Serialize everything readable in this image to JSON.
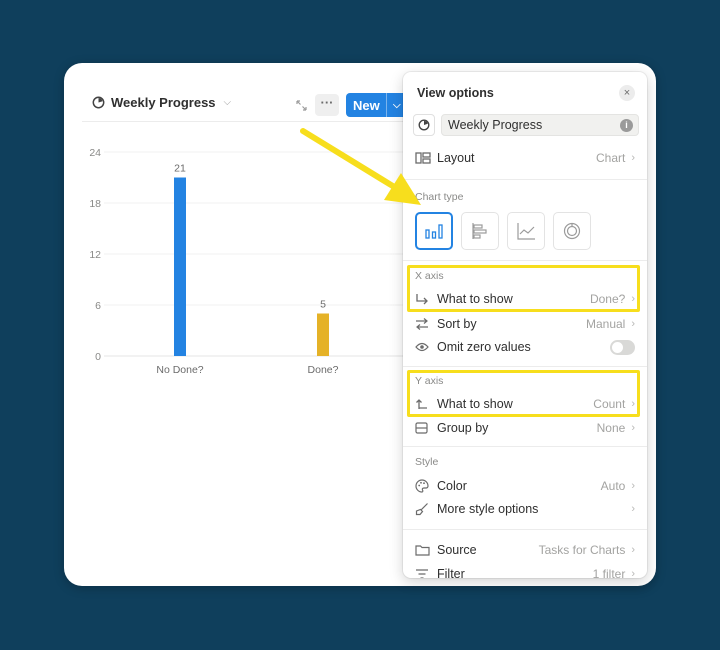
{
  "view": {
    "title": "Weekly Progress",
    "new_label": "New",
    "more_label": "···"
  },
  "chart_data": {
    "type": "bar",
    "categories": [
      "No Done?",
      "Done?"
    ],
    "values": [
      21,
      5
    ],
    "colors": [
      "#2383e2",
      "#e5b227"
    ],
    "ylim": [
      0,
      24
    ],
    "yticks": [
      0,
      6,
      12,
      18,
      24
    ],
    "data_labels": [
      "21",
      "5"
    ],
    "grid": true
  },
  "panel": {
    "title": "View options",
    "name_value": "Weekly Progress",
    "info": "i",
    "close": "×",
    "layout": {
      "label": "Layout",
      "value": "Chart"
    },
    "chart_type_label": "Chart type",
    "chart_types": [
      "vertical-bar",
      "horizontal-bar",
      "line",
      "donut"
    ],
    "x_axis": {
      "label": "X axis",
      "what_to_show": {
        "label": "What to show",
        "value": "Done?"
      },
      "sort_by": {
        "label": "Sort by",
        "value": "Manual"
      },
      "omit_zero": {
        "label": "Omit zero values",
        "on": false
      }
    },
    "y_axis": {
      "label": "Y axis",
      "what_to_show": {
        "label": "What to show",
        "value": "Count"
      },
      "group_by": {
        "label": "Group by",
        "value": "None"
      }
    },
    "style": {
      "label": "Style",
      "color": {
        "label": "Color",
        "value": "Auto"
      },
      "more": {
        "label": "More style options"
      }
    },
    "source": {
      "label": "Source",
      "value": "Tasks for Charts"
    },
    "filter": {
      "label": "Filter",
      "value": "1 filter"
    }
  },
  "colors": {
    "background": "#0f3f5c",
    "accent": "#2383e2",
    "highlight": "#f7de1d",
    "bar_blue": "#2383e2",
    "bar_yellow": "#e5b227"
  }
}
